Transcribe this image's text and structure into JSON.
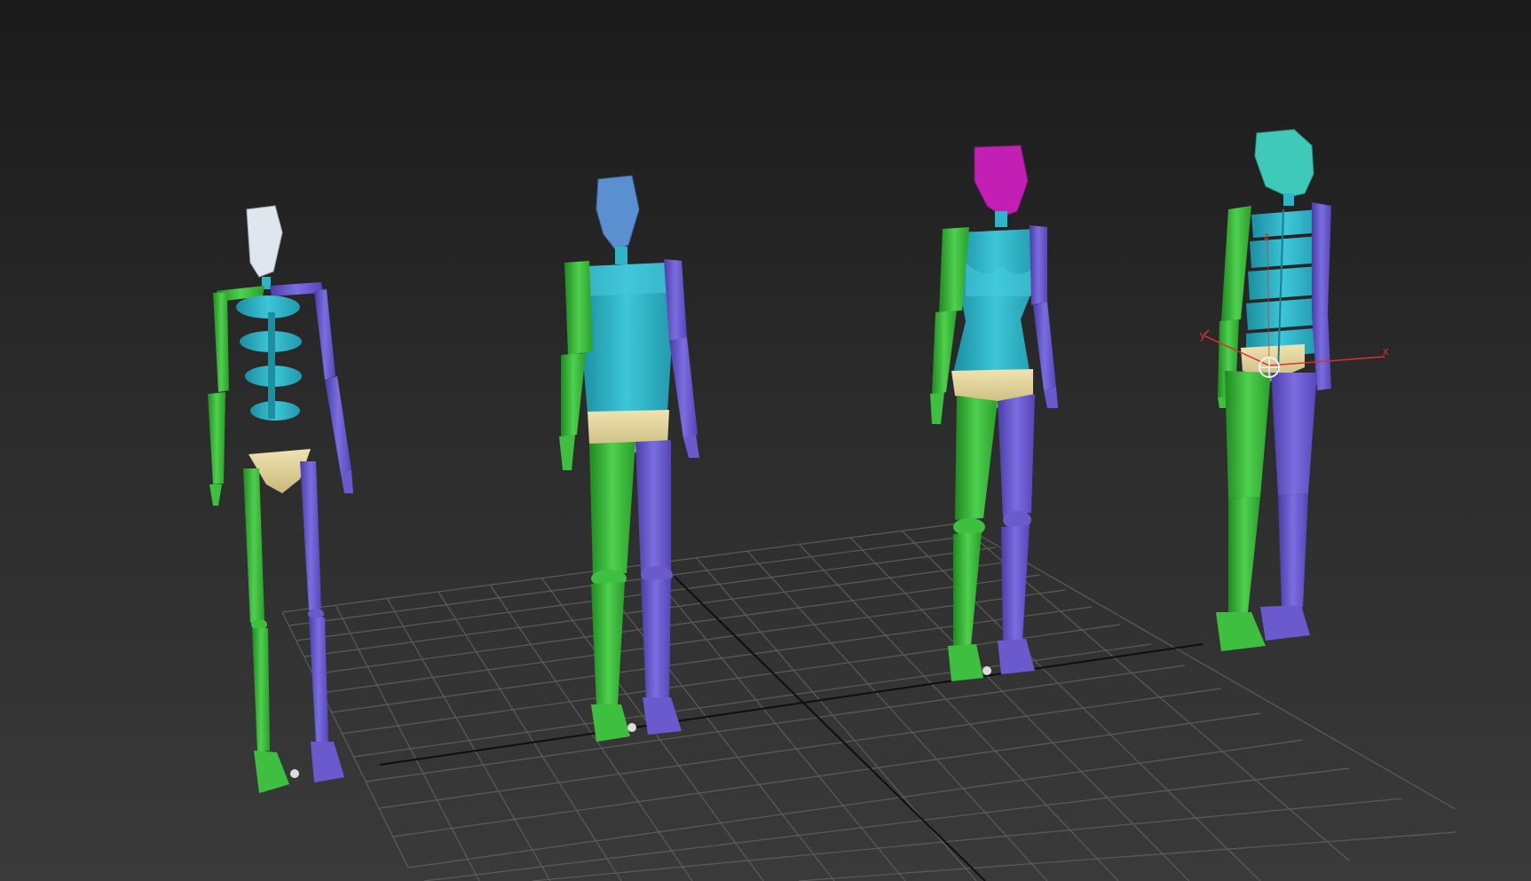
{
  "viewport": {
    "kind": "perspective-3d-viewport",
    "background_top": "#1a1a1a",
    "background_bottom": "#3a3a3a",
    "grid_color": "#5a5a5a",
    "grid_axis_color": "#111111"
  },
  "gizmo": {
    "axis_label_left": "y",
    "axis_label_right": "x",
    "axis_label_top": "z",
    "color": "#d93030"
  },
  "figures": [
    {
      "name": "skeleton-biped",
      "head_color": "#e6ecf2",
      "left_color": "#3fbf3f",
      "right_color": "#6a5acd",
      "spine_color": "#2fb5c8",
      "pelvis_color": "#e2d59a"
    },
    {
      "name": "classic-biped",
      "head_color": "#5a8fd0",
      "left_color": "#3fbf3f",
      "right_color": "#6a5acd",
      "torso_color": "#2fb5c8",
      "pelvis_color": "#e2d59a"
    },
    {
      "name": "female-biped",
      "head_color": "#c41fb4",
      "left_color": "#3fbf3f",
      "right_color": "#6a5acd",
      "torso_color": "#2fb5c8",
      "pelvis_color": "#e2d59a"
    },
    {
      "name": "box-biped-selected",
      "head_color": "#3ec9b8",
      "left_color": "#3fbf3f",
      "right_color": "#6a5acd",
      "torso_color": "#2fb5c8",
      "pelvis_color": "#e2d59a"
    }
  ]
}
